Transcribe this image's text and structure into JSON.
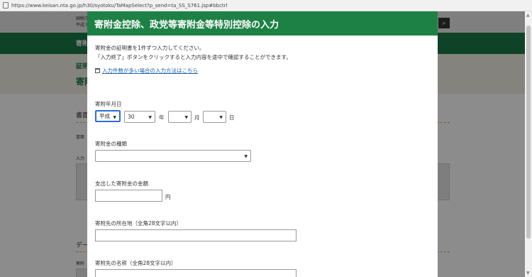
{
  "browser": {
    "url": "https://www.keisan.nta.go.jp/h30/syotoku/TaMapSelect?p_send=ta_SS_S761.jsp#bbctrl"
  },
  "background": {
    "header_line1": "国税庁",
    "header_line2": "平成３",
    "nav_text": "寄附",
    "band_small": "証明",
    "band_big": "寄附",
    "section1_heading": "書面",
    "section1_line": "書面",
    "section1_input": "入力",
    "section2_heading": "デー",
    "section2_line": "寄附"
  },
  "modal": {
    "title": "寄附金控除、政党等寄附金等特別控除の入力",
    "intro_line1": "寄附金の証明書を1件ずつ入力してください。",
    "intro_line2": "「入力終了」ボタンをクリックすると入力内容を途中で確認することができます。",
    "many_entries_link": "入力件数が多い場合の入力方法はこちら",
    "date": {
      "label": "寄附年月日",
      "era_value": "平成",
      "year_value": "30",
      "year_unit": "年",
      "month_value": "",
      "month_unit": "月",
      "day_value": "",
      "day_unit": "日"
    },
    "type": {
      "label": "寄附金の種類",
      "value": ""
    },
    "amount": {
      "label": "支出した寄附金の金額",
      "value": "",
      "unit": "円"
    },
    "address": {
      "label": "寄附先の所在地（全角28文字以内）",
      "value": ""
    },
    "name": {
      "label": "寄附先の名称（全角28文字以内）",
      "value": ""
    }
  }
}
